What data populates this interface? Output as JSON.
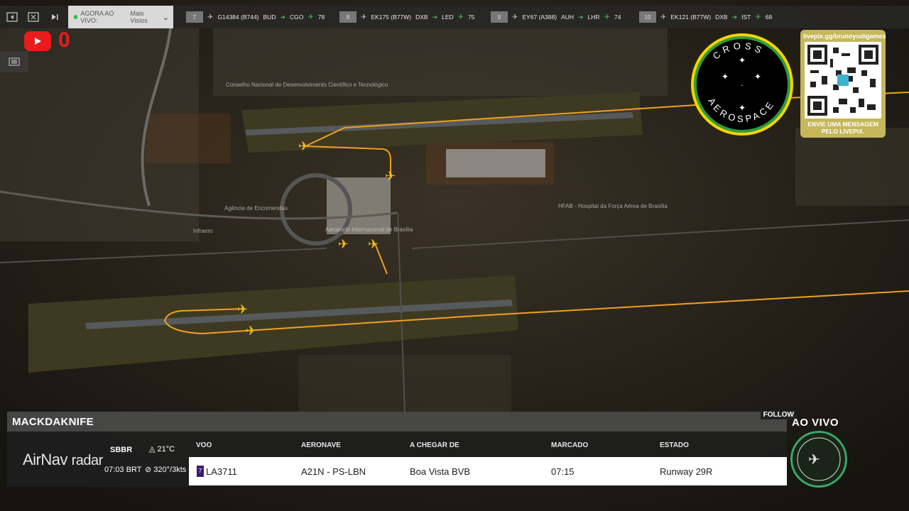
{
  "toolbar": {
    "live_label": "AGORA AO VIVO:",
    "live_value": "Mais Visíos",
    "icons": [
      "skip-back-icon",
      "screen-icon",
      "skip-forward-icon",
      "chevron-down-icon"
    ]
  },
  "flights": [
    {
      "index": "7",
      "flight": "G14384 (B744)",
      "origin": "BUD",
      "destination": "CGO",
      "count": "78"
    },
    {
      "index": "8",
      "flight": "EK175 (B77W)",
      "origin": "DXB",
      "destination": "LED",
      "count": "75"
    },
    {
      "index": "9",
      "flight": "EY67 (A388)",
      "origin": "AUH",
      "destination": "LHR",
      "count": "74"
    },
    {
      "index": "10",
      "flight": "EK121 (B77W)",
      "origin": "DXB",
      "destination": "IST",
      "count": "68"
    }
  ],
  "youtube": {
    "count": "0"
  },
  "map_labels": [
    "Conselho Nacional de Desenvolvimento Científico e Tecnológico",
    "Agência de Encomendas",
    "Aeroporto Internacional de Brasília",
    "HFAB - Hospital da Força Aérea de Brasília",
    "Infraero"
  ],
  "logo": {
    "text_top": "CROSS",
    "text_bottom": "AEROSPACE"
  },
  "qr": {
    "url": "livepix.gg/brunoyudigames",
    "message": "ENVIE UMA MENSAGEM PELO LIVEPIX."
  },
  "panel": {
    "callsign": "MACKDAKNIFE",
    "follow": "FOLLOW",
    "brand_main": "AirNav",
    "brand_sub": "radar",
    "icao": "SBBR",
    "local_time": "07:03 BRT",
    "temperature": "21°C",
    "wind": "320°/3kts",
    "headers": {
      "voo": "VOO",
      "aeronave": "AERONAVE",
      "origem": "A CHEGAR DE",
      "marcado": "MARCADO",
      "estado": "ESTADO"
    },
    "row": {
      "flag": "7",
      "voo": "LA3711",
      "aeronave": "A21N - PS-LBN",
      "origem": "Boa Vista BVB",
      "marcado": "07:15",
      "estado": "Runway 29R"
    }
  },
  "aovivo": "AO VIVO",
  "colors": {
    "route": "#f0a020",
    "accent_green": "#4caf50",
    "youtube_red": "#e81c1c",
    "qr_gold": "#c5b75a"
  }
}
